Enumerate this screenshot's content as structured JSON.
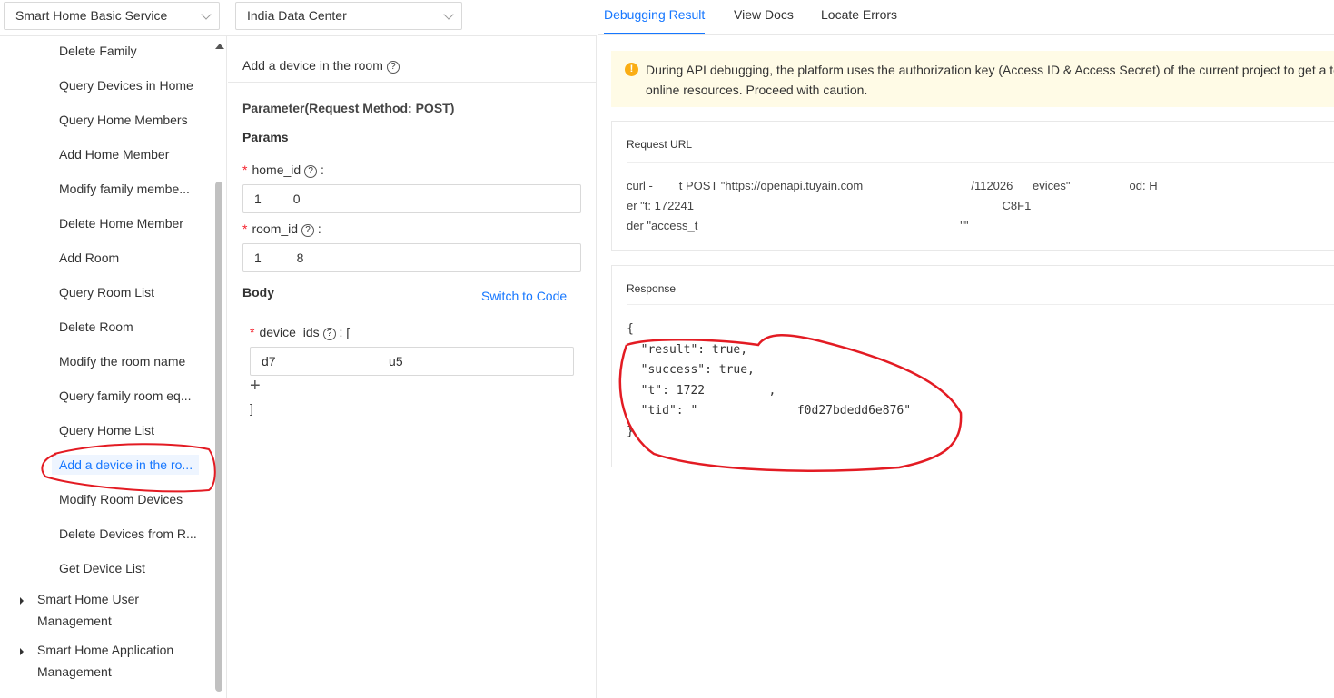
{
  "top": {
    "service_select": "Smart Home Basic Service",
    "datacenter_select": "India Data Center"
  },
  "sidebar": {
    "items": [
      "Delete Family",
      "Query Devices in Home",
      "Query Home Members",
      "Add Home Member",
      "Modify family membe...",
      "Delete Home Member",
      "Add Room",
      "Query Room List",
      "Delete Room",
      "Modify the room name",
      "Query family room eq...",
      "Query Home List",
      "Add a device in the ro...",
      "Modify Room Devices",
      "Delete Devices from R...",
      "Get Device List"
    ],
    "active_index": 12,
    "groups_l1": [
      "Smart Home User",
      "Smart Home Application"
    ],
    "groups_l2": [
      "Management",
      "Management"
    ]
  },
  "form": {
    "title": "Add a device in the room",
    "param_heading": "Parameter(Request Method: POST)",
    "params_label": "Params",
    "home_id_label": "home_id",
    "home_id_value": "1         0",
    "room_id_label": "room_id",
    "room_id_value": "1          8",
    "body_label": "Body",
    "switch_label": "Switch to Code",
    "device_ids_label": "device_ids",
    "device_ids_suffix": ": [",
    "device_id_value": "d7                                u5",
    "close_bracket": "]"
  },
  "tabs": [
    "Debugging Result",
    "View Docs",
    "Locate Errors"
  ],
  "notice": {
    "line1": "During API debugging, the platform uses the authorization key (Access ID & Access Secret) of the current project to get a to",
    "line2": "online resources. Proceed with caution."
  },
  "request": {
    "title": "Request URL",
    "lines": [
      "curl -        t POST \"https://openapi.tuyain.com                                 /112026      evices\"                  od: H",
      "er \"t: 172241                                                                                              C8F1",
      "der \"access_t                                                                                \"\""
    ]
  },
  "response": {
    "title": "Response",
    "body": "{\n  \"result\": true,\n  \"success\": true,\n  \"t\": 1722         ,\n  \"tid\": \"              f0d27bdedd6e876\"\n}"
  },
  "colors": {
    "accent": "#1677ff",
    "notice_bg": "#fffbe6",
    "annotation": "#e31b23"
  }
}
